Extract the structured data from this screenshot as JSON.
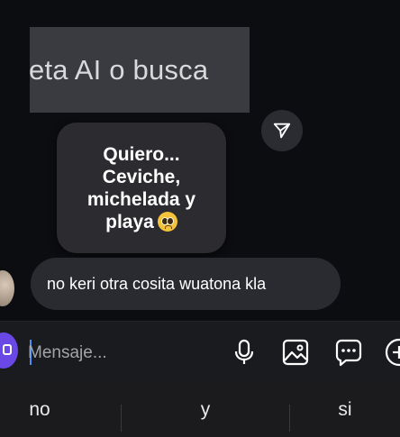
{
  "story_banner": {
    "text": "eta AI o busca"
  },
  "sticker": {
    "lines": [
      "Quiero...",
      "Ceviche,",
      "michelada y",
      "playa"
    ]
  },
  "message": {
    "text": "no keri otra cosita wuatona kla"
  },
  "composer": {
    "placeholder": "Mensaje..."
  },
  "keyboard": {
    "suggestions": [
      "no",
      "y",
      "si"
    ]
  },
  "colors": {
    "background": "#0c0d11",
    "bubble": "#2a2b30",
    "accent": "#6a48e6",
    "caret": "#4e8df5"
  },
  "icons": [
    "send-icon",
    "camera-icon",
    "microphone-icon",
    "gallery-icon",
    "sticker-icon",
    "add-icon"
  ]
}
